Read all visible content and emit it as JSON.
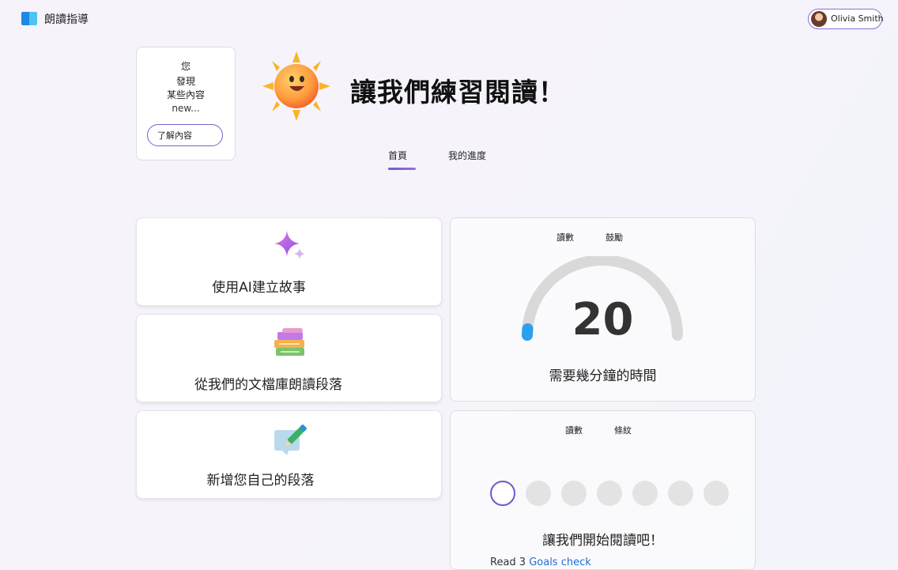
{
  "app": {
    "title": "朗讀指導"
  },
  "user": {
    "name": "Olivia Smith"
  },
  "discover": {
    "line1": "您",
    "line2": "發現",
    "line3": "某些內容",
    "line4": "new...",
    "button_label": "了解內容"
  },
  "hero": {
    "title": "讓我們練習閱讀！"
  },
  "tabs": [
    {
      "label": "首頁",
      "selected": true
    },
    {
      "label": "我的進度",
      "selected": false
    }
  ],
  "cards": {
    "ai_story": {
      "label": "使用AI建立故事",
      "icon": "sparkle-icon"
    },
    "library": {
      "label": "從我們的文檔庫朗讀段落",
      "icon": "books-icon"
    },
    "own": {
      "label": "新增您自己的段落",
      "icon": "pencil-paper-icon"
    }
  },
  "gauge_panel": {
    "tab1": "讀數",
    "tab2": "鼓勵",
    "value": "20",
    "caption": "需要幾分鐘的時間",
    "accent": "#2ba0f0"
  },
  "streak_panel": {
    "tab1": "讀數",
    "tab2": "條紋",
    "dots_total": 7,
    "dots_active": 1,
    "message": "讓我們開始閱讀吧！",
    "sub_text": "Read 3 ",
    "sub_link": "Goals check"
  },
  "colors": {
    "accent_purple": "#7a5fd0",
    "tab_underline": "#6b5bd6",
    "logo_blue": "#1e88e5"
  }
}
